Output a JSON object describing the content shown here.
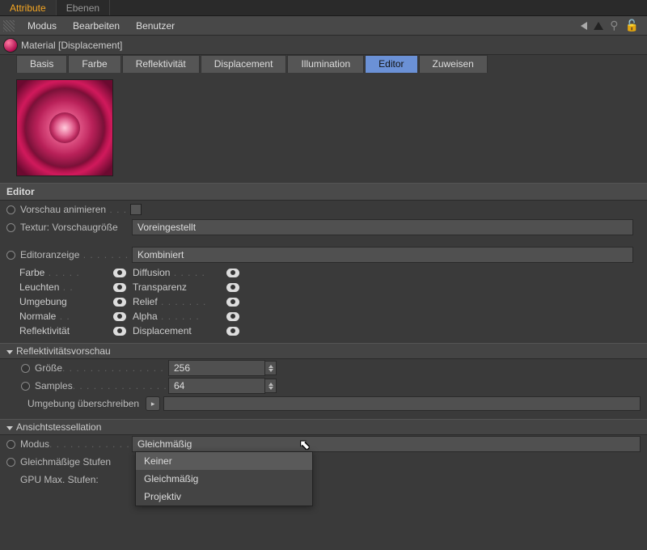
{
  "topTabs": {
    "active": "Attribute",
    "other": "Ebenen"
  },
  "menu": {
    "mode": "Modus",
    "edit": "Bearbeiten",
    "user": "Benutzer"
  },
  "title": "Material [Displacement]",
  "paramTabs": {
    "basis": "Basis",
    "farbe": "Farbe",
    "reflekt": "Reflektivität",
    "disp": "Displacement",
    "illum": "Illumination",
    "editor": "Editor",
    "zuweisen": "Zuweisen"
  },
  "editor": {
    "head": "Editor",
    "previewAnim": "Vorschau animieren",
    "texSize": "Textur: Vorschaugröße",
    "texSizeVal": "Voreingestellt",
    "display": "Editoranzeige",
    "displayVal": "Kombiniert",
    "channels": {
      "farbe": "Farbe",
      "diffusion": "Diffusion",
      "leuchten": "Leuchten",
      "transparenz": "Transparenz",
      "umgebung": "Umgebung",
      "relief": "Relief",
      "normale": "Normale",
      "alpha": "Alpha",
      "reflekt": "Reflektivität",
      "disp": "Displacement"
    }
  },
  "reflect": {
    "head": "Reflektivitätsvorschau",
    "size": "Größe",
    "sizeVal": "256",
    "samples": "Samples",
    "samplesVal": "64",
    "override": "Umgebung überschreiben"
  },
  "tess": {
    "head": "Ansichtstessellation",
    "mode": "Modus",
    "modeVal": "Gleichmäßig",
    "steps": "Gleichmäßige Stufen",
    "gpu": "GPU Max. Stufen:",
    "options": {
      "none": "Keiner",
      "uniform": "Gleichmäßig",
      "projective": "Projektiv"
    }
  }
}
